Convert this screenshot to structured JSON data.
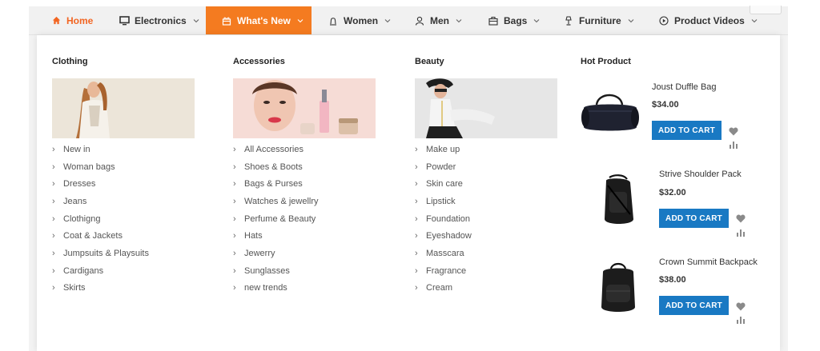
{
  "nav": {
    "items": [
      {
        "label": "Home",
        "icon": "home-icon"
      },
      {
        "label": "Electronics",
        "icon": "monitor-icon"
      },
      {
        "label": "What's New",
        "icon": "gift-icon"
      },
      {
        "label": "Women",
        "icon": "female-icon"
      },
      {
        "label": "Men",
        "icon": "user-icon"
      },
      {
        "label": "Bags",
        "icon": "briefcase-icon"
      },
      {
        "label": "Furniture",
        "icon": "lamp-icon"
      },
      {
        "label": "Product Videos",
        "icon": "play-circle-icon"
      }
    ],
    "active_index": 2
  },
  "menu": {
    "clothing": {
      "title": "Clothing",
      "items": [
        "New in",
        "Woman bags",
        "Dresses",
        "Jeans",
        "Clothigng",
        "Coat & Jackets",
        "Jumpsuits & Playsuits",
        "Cardigans",
        "Skirts"
      ]
    },
    "accessories": {
      "title": "Accessories",
      "items": [
        "All Accessories",
        "Shoes & Boots",
        "Bags & Purses",
        "Watches & jewellry",
        "Perfume & Beauty",
        "Hats",
        "Jewerry",
        "Sunglasses",
        "new trends"
      ]
    },
    "beauty": {
      "title": "Beauty",
      "items": [
        "Make up",
        "Powder",
        "Skin care",
        "Lipstick",
        "Foundation",
        "Eyeshadow",
        "Masscara",
        "Fragrance",
        "Cream"
      ]
    },
    "hot": {
      "title": "Hot Product",
      "add_label": "ADD TO CART",
      "products": [
        {
          "name": "Joust Duffle Bag",
          "price": "$34.00"
        },
        {
          "name": "Strive Shoulder Pack",
          "price": "$32.00"
        },
        {
          "name": "Crown Summit Backpack",
          "price": "$38.00"
        }
      ]
    }
  },
  "colors": {
    "accent": "#f47b20",
    "button": "#1979c3"
  }
}
